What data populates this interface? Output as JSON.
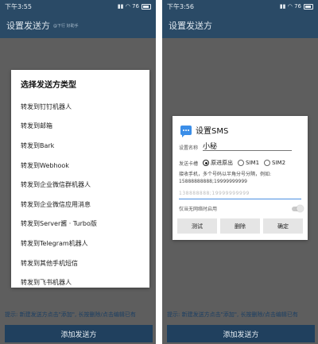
{
  "left": {
    "status_time": "下午3:55",
    "status_icons": "▮▮ ◠ 76",
    "app_title": "设置发送方",
    "app_sub": "@下行 好助手",
    "chooser_title": "选择发送方类型",
    "options": [
      "转发到钉钉机器人",
      "转发到邮箱",
      "转发到Bark",
      "转发到Webhook",
      "转发到企业微信群机器人",
      "转发到企业微信应用消息",
      "转发到Server酱 · Turbo版",
      "转发到Telegram机器人",
      "转发到其他手机短信",
      "转发到飞书机器人"
    ],
    "tip": "提示: 新建发送方点击\"添加\", 长按删除/点击编辑已有",
    "add_button": "添加发送方"
  },
  "right": {
    "status_time": "下午3:56",
    "status_icons": "▮▮ ◠ 76",
    "app_title": "设置发送方",
    "sms": {
      "title": "设置SMS",
      "name_label": "设置名称",
      "name_value": "小秘",
      "card_label": "发送卡槽",
      "radio_options": [
        "原进原出",
        "SIM1",
        "SIM2"
      ],
      "hint": "接收手机，多个号码以半角分号分隔，例如: 15888888888;19999999999",
      "phone_value": "138888888;19999999999",
      "offline_label": "仅当无网络时启用",
      "test_button": "测试",
      "delete_button": "删除",
      "confirm_button": "确定"
    },
    "tip": "提示: 新建发送方点击\"添加\", 长按删除/点击编辑已有",
    "add_button": "添加发送方"
  }
}
